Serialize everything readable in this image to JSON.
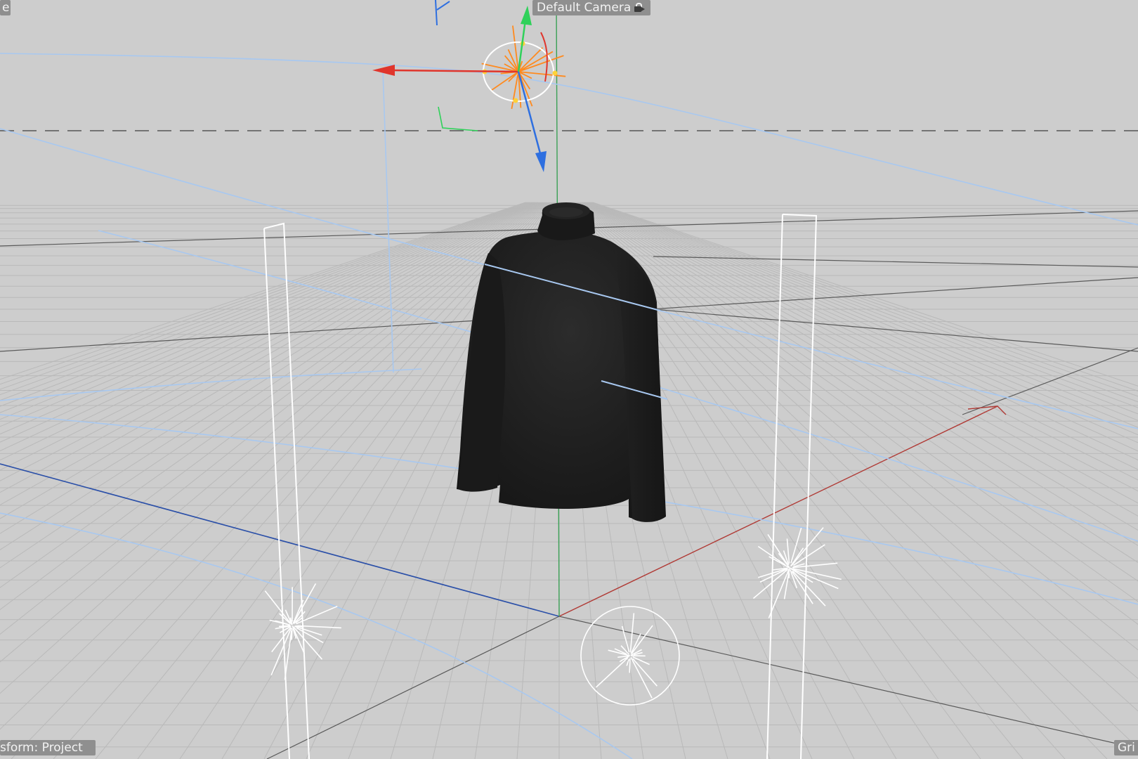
{
  "viewport": {
    "background": "#cdcdcd",
    "camera_label": "Default Camera",
    "camera_icon": "camera-lock-icon",
    "left_top_label": "e",
    "transform_status": "sform: Project",
    "grid_label": "Gri"
  },
  "scene": {
    "objects": [
      {
        "name": "Sweater",
        "type": "mesh",
        "color": "#1e1e1e"
      },
      {
        "name": "Light left",
        "type": "light",
        "color": "#ffffff"
      },
      {
        "name": "Light center",
        "type": "light",
        "color": "#ffffff"
      },
      {
        "name": "Light right",
        "type": "light",
        "color": "#ffffff"
      },
      {
        "name": "Area light left",
        "type": "area-light-outline",
        "color": "#ffffff"
      },
      {
        "name": "Area light right",
        "type": "area-light-outline",
        "color": "#ffffff"
      }
    ],
    "axis_colors": {
      "x": "#e0352c",
      "y": "#2fd15a",
      "z": "#2e6fe0",
      "world_x": "#b03a35",
      "world_z": "#2a4fa8",
      "world_y": "#3aa055",
      "spline": "#a8c8f0",
      "gizmo_orange": "#ff8a1e"
    }
  }
}
